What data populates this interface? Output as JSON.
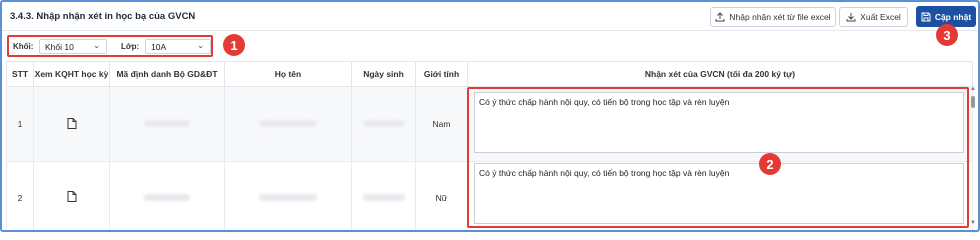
{
  "header": {
    "title": "3.4.3. Nhập nhận xét in học bạ của GVCN",
    "import_label": "Nhập nhận xét từ file excel",
    "export_label": "Xuất Excel",
    "update_label": "Cập nhật"
  },
  "filters": {
    "grade_label": "Khối:",
    "grade_value": "Khối 10",
    "class_label": "Lớp:",
    "class_value": "10A"
  },
  "callouts": [
    "1",
    "2",
    "3"
  ],
  "table": {
    "columns": [
      "STT",
      "Xem KQHT học kỳ",
      "Mã định danh Bộ GD&ĐT",
      "Họ tên",
      "Ngày sinh",
      "Giới tính",
      "Nhận xét của GVCN (tối đa 200 ký tự)"
    ],
    "rows": [
      {
        "stt": "1",
        "gender": "Nam",
        "comment": "Có ý thức chấp hành nội quy, có tiến bộ trong học tập và rèn luyện"
      },
      {
        "stt": "2",
        "gender": "Nữ",
        "comment": "Có ý thức chấp hành nội quy, có tiến bộ trong học tập và rèn luyện"
      }
    ]
  },
  "colors": {
    "primary": "#1d4fa3",
    "highlight": "#e53935",
    "frame": "#5b8fd6"
  }
}
